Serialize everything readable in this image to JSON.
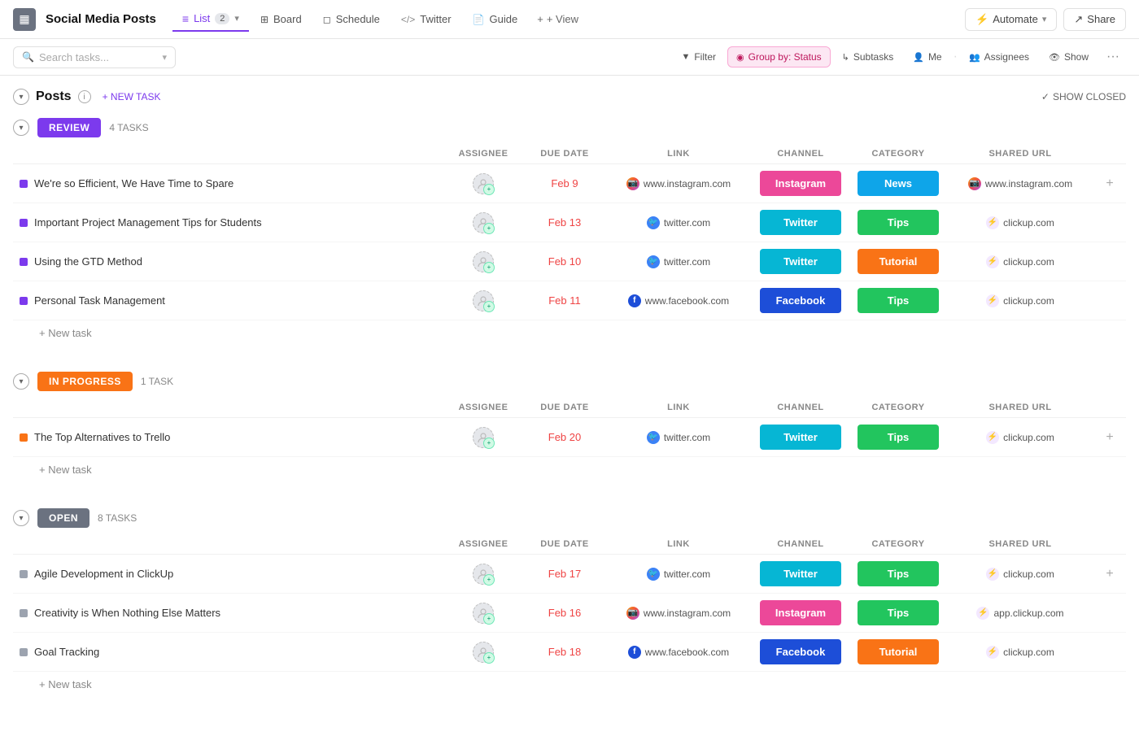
{
  "app": {
    "icon": "≡",
    "title": "Social Media Posts"
  },
  "nav": {
    "tabs": [
      {
        "id": "list",
        "label": "List",
        "badge": "2",
        "icon": "≡",
        "active": true
      },
      {
        "id": "board",
        "label": "Board",
        "icon": "⊞",
        "active": false
      },
      {
        "id": "schedule",
        "label": "Schedule",
        "icon": "📅",
        "active": false
      },
      {
        "id": "twitter",
        "label": "Twitter",
        "icon": "</>",
        "active": false
      },
      {
        "id": "guide",
        "label": "Guide",
        "icon": "📄",
        "active": false
      }
    ],
    "view_label": "+ View",
    "automate_label": "Automate",
    "share_label": "Share"
  },
  "toolbar": {
    "search_placeholder": "Search tasks...",
    "filter_label": "Filter",
    "group_by_label": "Group by: Status",
    "subtasks_label": "Subtasks",
    "me_label": "Me",
    "assignees_label": "Assignees",
    "show_label": "Show"
  },
  "posts_section": {
    "title": "Posts",
    "new_task_label": "+ NEW TASK",
    "show_closed_label": "SHOW CLOSED"
  },
  "groups": [
    {
      "id": "review",
      "label": "REVIEW",
      "count_label": "4 TASKS",
      "color_class": "review",
      "columns": [
        "ASSIGNEE",
        "DUE DATE",
        "LINK",
        "CHANNEL",
        "CATEGORY",
        "SHARED URL"
      ],
      "tasks": [
        {
          "name": "We're so Efficient, We Have Time to Spare",
          "dot": "purple",
          "due": "Feb 9",
          "link_icon": "instagram",
          "link_url": "www.instagram.com",
          "channel": "Instagram",
          "channel_class": "instagram",
          "category": "News",
          "category_class": "news",
          "shared_icon": "instagram",
          "shared_url": "www.instagram.com"
        },
        {
          "name": "Important Project Management Tips for Students",
          "dot": "purple",
          "due": "Feb 13",
          "link_icon": "twitter",
          "link_url": "twitter.com",
          "channel": "Twitter",
          "channel_class": "twitter",
          "category": "Tips",
          "category_class": "tips",
          "shared_icon": "clickup",
          "shared_url": "clickup.com"
        },
        {
          "name": "Using the GTD Method",
          "dot": "purple",
          "due": "Feb 10",
          "link_icon": "twitter",
          "link_url": "twitter.com",
          "channel": "Twitter",
          "channel_class": "twitter",
          "category": "Tutorial",
          "category_class": "tutorial",
          "shared_icon": "clickup",
          "shared_url": "clickup.com"
        },
        {
          "name": "Personal Task Management",
          "dot": "purple",
          "due": "Feb 11",
          "link_icon": "facebook",
          "link_url": "www.facebook.com",
          "channel": "Facebook",
          "channel_class": "facebook",
          "category": "Tips",
          "category_class": "tips",
          "shared_icon": "clickup",
          "shared_url": "clickup.com"
        }
      ],
      "new_task_label": "+ New task"
    },
    {
      "id": "inprogress",
      "label": "IN PROGRESS",
      "count_label": "1 TASK",
      "color_class": "inprogress",
      "columns": [
        "ASSIGNEE",
        "DUE DATE",
        "LINK",
        "CHANNEL",
        "CATEGORY",
        "SHARED URL"
      ],
      "tasks": [
        {
          "name": "The Top Alternatives to Trello",
          "dot": "orange",
          "due": "Feb 20",
          "link_icon": "twitter",
          "link_url": "twitter.com",
          "channel": "Twitter",
          "channel_class": "twitter",
          "category": "Tips",
          "category_class": "tips",
          "shared_icon": "clickup",
          "shared_url": "clickup.com"
        }
      ],
      "new_task_label": "+ New task"
    },
    {
      "id": "open",
      "label": "OPEN",
      "count_label": "8 TASKS",
      "color_class": "open",
      "columns": [
        "ASSIGNEE",
        "DUE DATE",
        "LINK",
        "CHANNEL",
        "CATEGORY",
        "SHARED URL"
      ],
      "tasks": [
        {
          "name": "Agile Development in ClickUp",
          "dot": "gray",
          "due": "Feb 17",
          "link_icon": "twitter",
          "link_url": "twitter.com",
          "channel": "Twitter",
          "channel_class": "twitter",
          "category": "Tips",
          "category_class": "tips",
          "shared_icon": "clickup",
          "shared_url": "clickup.com"
        },
        {
          "name": "Creativity is When Nothing Else Matters",
          "dot": "gray",
          "due": "Feb 16",
          "link_icon": "instagram",
          "link_url": "www.instagram.com",
          "channel": "Instagram",
          "channel_class": "instagram",
          "category": "Tips",
          "category_class": "tips",
          "shared_icon": "clickup",
          "shared_url": "app.clickup.com"
        },
        {
          "name": "Goal Tracking",
          "dot": "gray",
          "due": "Feb 18",
          "link_icon": "facebook",
          "link_url": "www.facebook.com",
          "channel": "Facebook",
          "channel_class": "facebook",
          "category": "Tutorial",
          "category_class": "tutorial",
          "shared_icon": "clickup",
          "shared_url": "clickup.com"
        }
      ],
      "new_task_label": "+ New task"
    }
  ],
  "icons": {
    "instagram": "📷",
    "twitter": "🐦",
    "facebook": "f",
    "clickup": "⚡",
    "search": "🔍",
    "chevron_down": "▾",
    "collapse": "▾",
    "info": "i",
    "plus": "+",
    "check": "✓",
    "dots": "•••",
    "filter": "▼",
    "people": "👤",
    "eye": "👁",
    "subtasks": "↳",
    "automate": "⚡",
    "share": "↗"
  },
  "colors": {
    "purple": "#7c3aed",
    "orange": "#f97316",
    "cyan": "#06b6d4",
    "pink": "#ec4899",
    "blue": "#1d4ed8",
    "green": "#22c55e",
    "sky": "#0ea5e9",
    "gray": "#6b7280"
  }
}
